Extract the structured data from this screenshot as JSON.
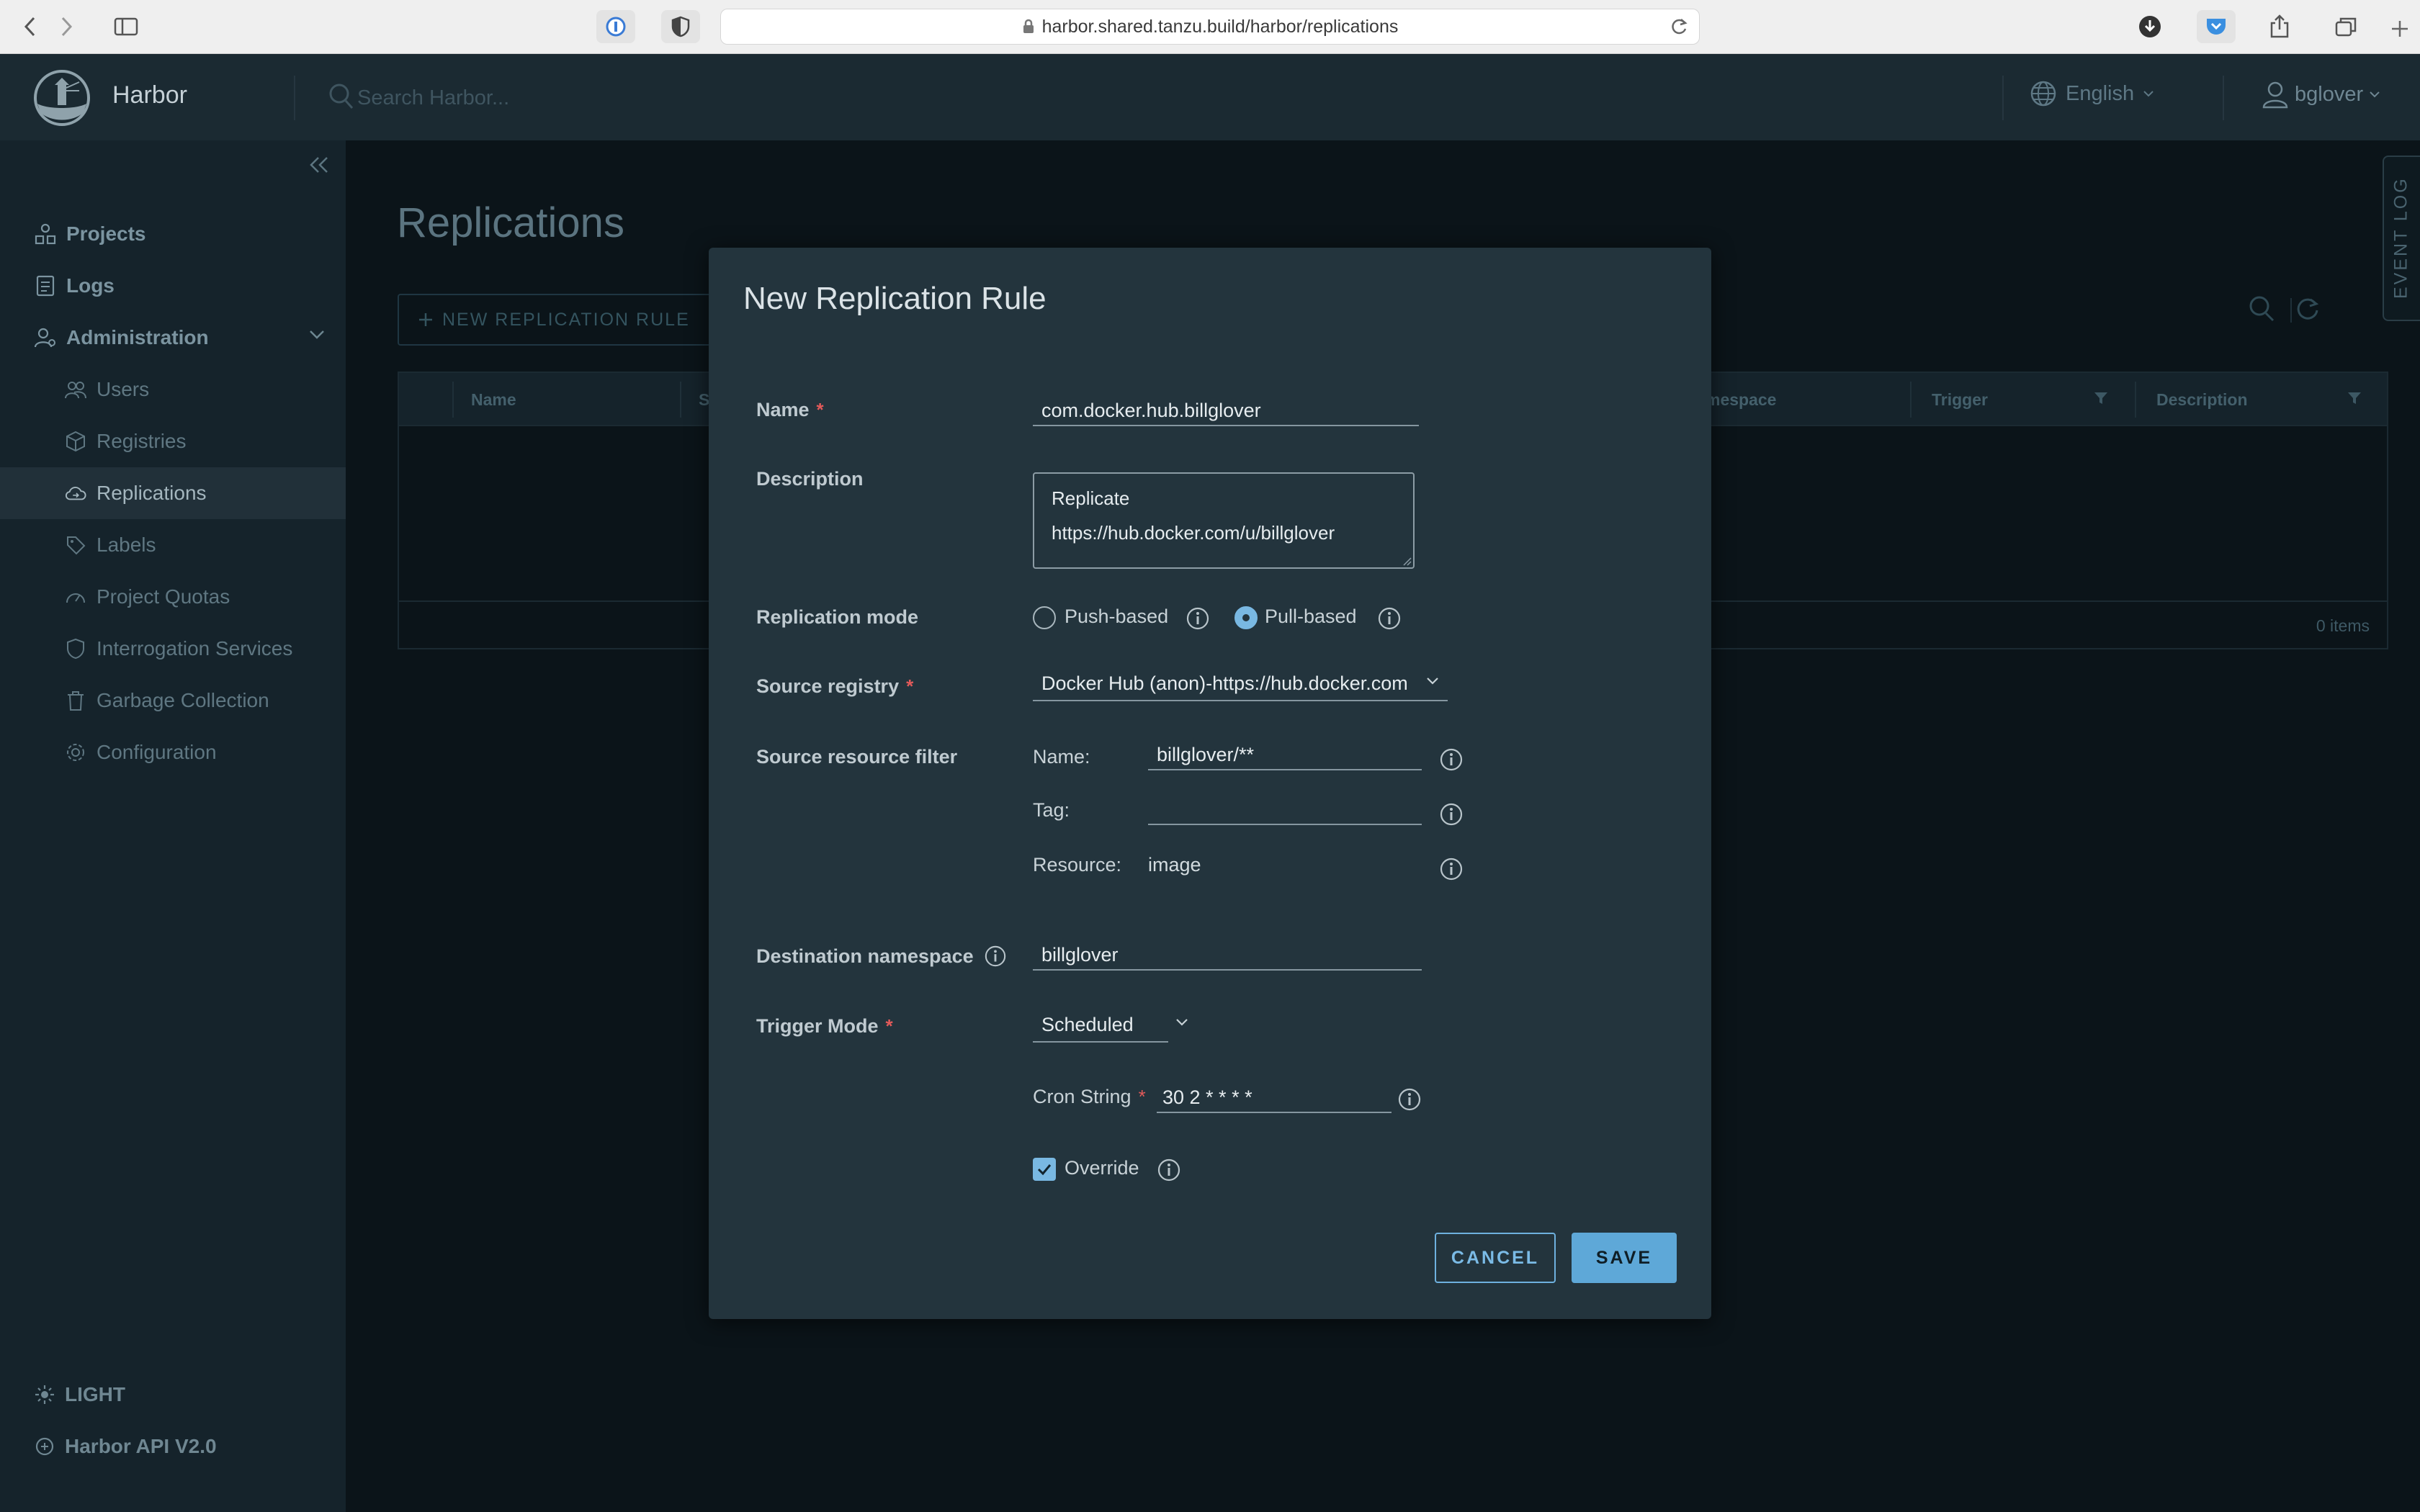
{
  "browser": {
    "url": "harbor.shared.tanzu.build/harbor/replications"
  },
  "header": {
    "brand": "Harbor",
    "search_placeholder": "Search Harbor...",
    "language": "English",
    "username": "bglover"
  },
  "sidebar": {
    "items": [
      {
        "label": "Projects",
        "icon": "projects-icon"
      },
      {
        "label": "Logs",
        "icon": "logs-icon"
      },
      {
        "label": "Administration",
        "icon": "administration-icon"
      }
    ],
    "admin_items": [
      {
        "label": "Users",
        "icon": "users-icon"
      },
      {
        "label": "Registries",
        "icon": "registries-icon"
      },
      {
        "label": "Replications",
        "icon": "replications-icon",
        "active": true
      },
      {
        "label": "Labels",
        "icon": "labels-icon"
      },
      {
        "label": "Project Quotas",
        "icon": "quotas-icon"
      },
      {
        "label": "Interrogation Services",
        "icon": "shield-icon"
      },
      {
        "label": "Garbage Collection",
        "icon": "trash-icon"
      },
      {
        "label": "Configuration",
        "icon": "gear-icon"
      }
    ],
    "theme_toggle": "LIGHT",
    "api_link": "Harbor API V2.0"
  },
  "main": {
    "title": "Replications",
    "new_rule_button": "NEW REPLICATION RULE",
    "columns": {
      "name": "Name",
      "status_partial": "S",
      "namespace_partial": "mespace",
      "trigger": "Trigger",
      "description": "Description"
    },
    "items_count": "0 items",
    "event_log": "EVENT LOG"
  },
  "modal": {
    "title": "New Replication Rule",
    "name_label": "Name",
    "name_value": "com.docker.hub.billglover",
    "description_label": "Description",
    "description_value": "Replicate https://hub.docker.com/u/billglover",
    "replication_mode_label": "Replication mode",
    "mode_push": "Push-based",
    "mode_pull": "Pull-based",
    "mode_selected": "pull",
    "source_registry_label": "Source registry",
    "source_registry_value": "Docker Hub (anon)-https://hub.docker.com",
    "source_filter_label": "Source resource filter",
    "filter_name_label": "Name:",
    "filter_name_value": "billglover/**",
    "filter_tag_label": "Tag:",
    "filter_tag_value": "",
    "filter_resource_label": "Resource:",
    "filter_resource_value": "image",
    "dest_namespace_label": "Destination namespace",
    "dest_namespace_value": "billglover",
    "trigger_mode_label": "Trigger Mode",
    "trigger_mode_value": "Scheduled",
    "cron_label": "Cron String",
    "cron_value": "30 2 * * * *",
    "override_label": "Override",
    "override_checked": true,
    "cancel_button": "CANCEL",
    "save_button": "SAVE"
  },
  "colors": {
    "accent": "#5ea8d8",
    "required": "#e25a5a",
    "modal_bg": "#23343d",
    "page_bg": "#0b1419"
  }
}
